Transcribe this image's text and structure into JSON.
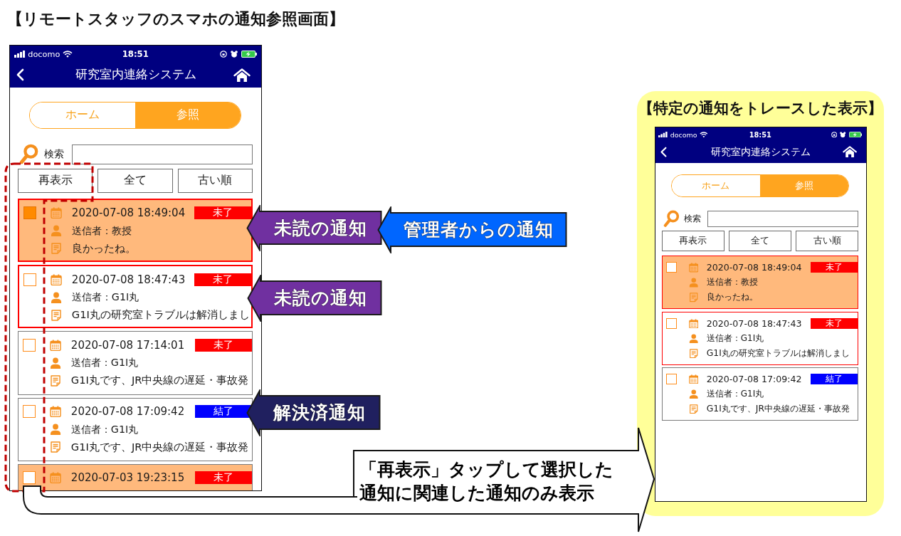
{
  "title": "【リモートスタッフのスマホの通知参照画面】",
  "main_phone": {
    "status_bar": {
      "carrier": "docomo",
      "time": "18:51"
    },
    "header": {
      "title": "研究室内連絡システム"
    },
    "tabs": [
      {
        "label": "ホーム",
        "selected": false
      },
      {
        "label": "参照",
        "selected": true
      }
    ],
    "search": {
      "label": "検索"
    },
    "buttons": [
      "再表示",
      "全て",
      "古い順"
    ],
    "notifications": [
      {
        "checked": true,
        "highlighted": true,
        "framed": true,
        "datetime": "2020-07-08 18:49:04",
        "status": "未了",
        "color": "#ff0000",
        "sender": "送信者：教授",
        "message": "良かったね。"
      },
      {
        "checked": false,
        "highlighted": false,
        "framed": true,
        "datetime": "2020-07-08 18:47:43",
        "status": "未了",
        "color": "#ff0000",
        "sender": "送信者：G1I丸",
        "message": "G1I丸の研究室トラブルは解消しまし"
      },
      {
        "checked": false,
        "highlighted": false,
        "framed": false,
        "datetime": "2020-07-08 17:14:01",
        "status": "未了",
        "color": "#ff0000",
        "sender": "送信者：G1I丸",
        "message": "G1I丸です、JR中央線の遅延・事故発"
      },
      {
        "checked": false,
        "highlighted": false,
        "framed": false,
        "datetime": "2020-07-08 17:09:42",
        "status": "結了",
        "color": "#0000ff",
        "sender": "送信者：G1I丸",
        "message": "G1I丸です、JR中央線の遅延・事故発"
      },
      {
        "checked": false,
        "highlighted": true,
        "framed": false,
        "datetime": "2020-07-03 19:23:15",
        "status": "未了",
        "color": "#ff0000"
      }
    ]
  },
  "callouts": [
    {
      "text": "未読の通知",
      "color": "#7030a0"
    },
    {
      "text": "管理者からの通知",
      "color": "#0066ff"
    },
    {
      "text": "未読の通知",
      "color": "#7030a0"
    },
    {
      "text": "解決済通知",
      "color": "#20205f"
    }
  ],
  "note": {
    "text": "「再表示」タップして選択した通知に関連した通知のみ表示"
  },
  "trace_panel": {
    "title": "【特定の通知をトレースした表示】",
    "phone": {
      "status_bar": {
        "carrier": "docomo",
        "time": "18:51"
      },
      "header": {
        "title": "研究室内連絡システム"
      },
      "tabs": [
        {
          "label": "ホーム",
          "selected": false
        },
        {
          "label": "参照",
          "selected": true
        }
      ],
      "search": {
        "label": "検索"
      },
      "buttons": [
        "再表示",
        "全て",
        "古い順"
      ],
      "notifications": [
        {
          "checked": false,
          "highlighted": true,
          "framed": true,
          "datetime": "2020-07-08 18:49:04",
          "status": "未了",
          "color": "#ff0000",
          "sender": "送信者：教授",
          "message": "良かったね。"
        },
        {
          "checked": false,
          "highlighted": false,
          "framed": true,
          "datetime": "2020-07-08 18:47:43",
          "status": "未了",
          "color": "#ff0000",
          "sender": "送信者：G1I丸",
          "message": "G1I丸の研究室トラブルは解消しまし"
        },
        {
          "checked": false,
          "highlighted": false,
          "framed": false,
          "datetime": "2020-07-08 17:09:42",
          "status": "結了",
          "color": "#0000ff",
          "sender": "送信者：G1I丸",
          "message": "G1I丸です、JR中央線の遅延・事故発"
        }
      ]
    }
  }
}
